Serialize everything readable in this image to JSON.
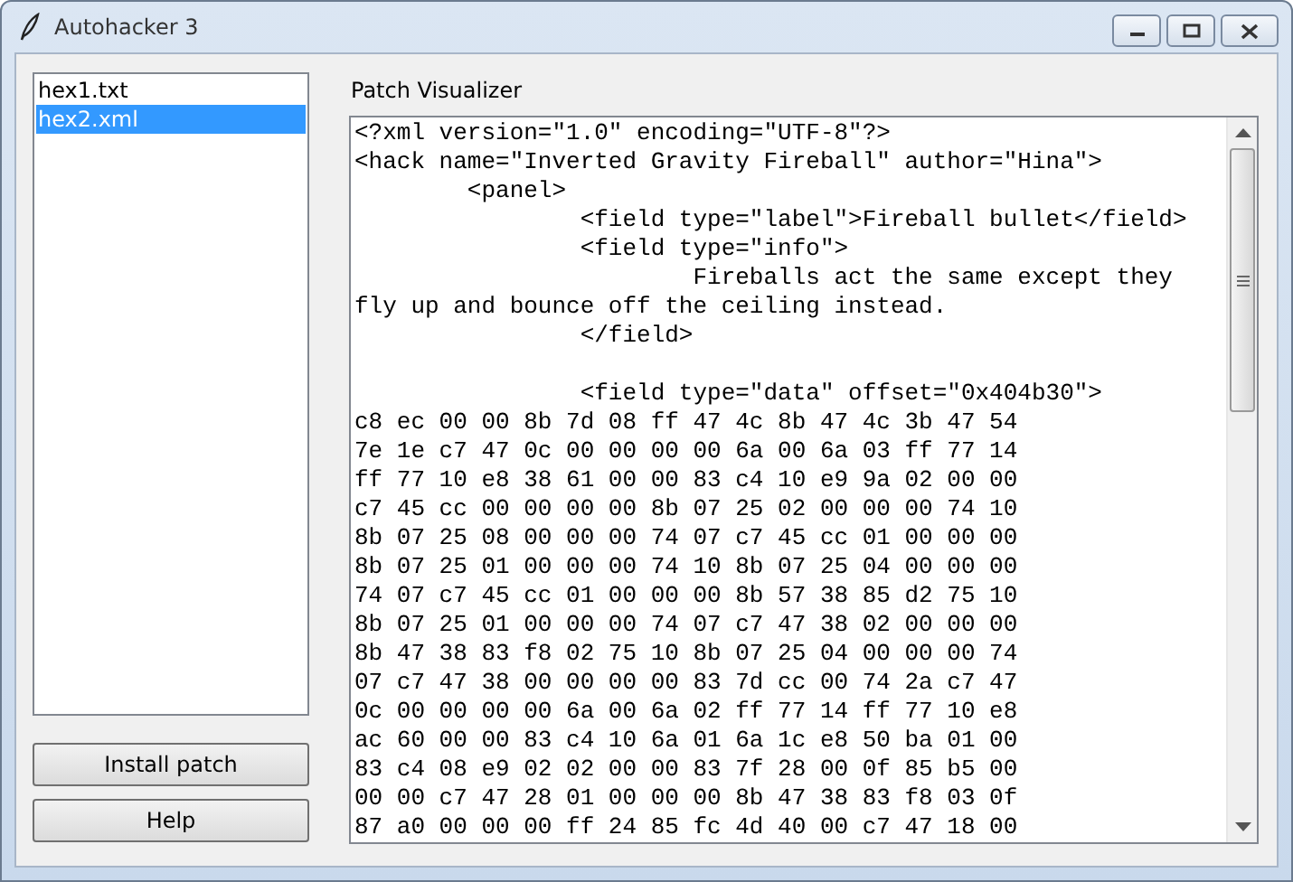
{
  "window": {
    "title": "Autohacker 3"
  },
  "files": [
    {
      "label": "hex1.txt",
      "selected": false
    },
    {
      "label": "hex2.xml",
      "selected": true
    }
  ],
  "buttons": [
    "Install patch",
    "Help"
  ],
  "visualizer": {
    "label": "Patch Visualizer",
    "header_lines": [
      "<?xml version=\"1.0\" encoding=\"UTF-8\"?>",
      "<hack name=\"Inverted Gravity Fireball\" author=\"Hina\">",
      "        <panel>",
      "                <field type=\"label\">Fireball bullet</field>",
      "                <field type=\"info\">",
      "                        Fireballs act the same except they",
      "fly up and bounce off the ceiling instead.",
      "                </field>"
    ],
    "data_lines": [
      "                <field type=\"data\" offset=\"0x404b30\">",
      "c8 ec 00 00 8b 7d 08 ff 47 4c 8b 47 4c 3b 47 54",
      "7e 1e c7 47 0c 00 00 00 00 6a 00 6a 03 ff 77 14",
      "ff 77 10 e8 38 61 00 00 83 c4 10 e9 9a 02 00 00",
      "c7 45 cc 00 00 00 00 8b 07 25 02 00 00 00 74 10",
      "8b 07 25 08 00 00 00 74 07 c7 45 cc 01 00 00 00",
      "8b 07 25 01 00 00 00 74 10 8b 07 25 04 00 00 00",
      "74 07 c7 45 cc 01 00 00 00 8b 57 38 85 d2 75 10",
      "8b 07 25 01 00 00 00 74 07 c7 47 38 02 00 00 00",
      "8b 47 38 83 f8 02 75 10 8b 07 25 04 00 00 00 74",
      "07 c7 47 38 00 00 00 00 83 7d cc 00 74 2a c7 47",
      "0c 00 00 00 00 6a 00 6a 02 ff 77 14 ff 77 10 e8",
      "ac 60 00 00 83 c4 10 6a 01 6a 1c e8 50 ba 01 00",
      "83 c4 08 e9 02 02 00 00 83 7f 28 00 0f 85 b5 00",
      "00 00 c7 47 28 01 00 00 00 8b 47 38 83 f8 03 0f",
      "87 a0 00 00 00 ff 24 85 fc 4d 40 00 c7 47 18 00"
    ]
  }
}
